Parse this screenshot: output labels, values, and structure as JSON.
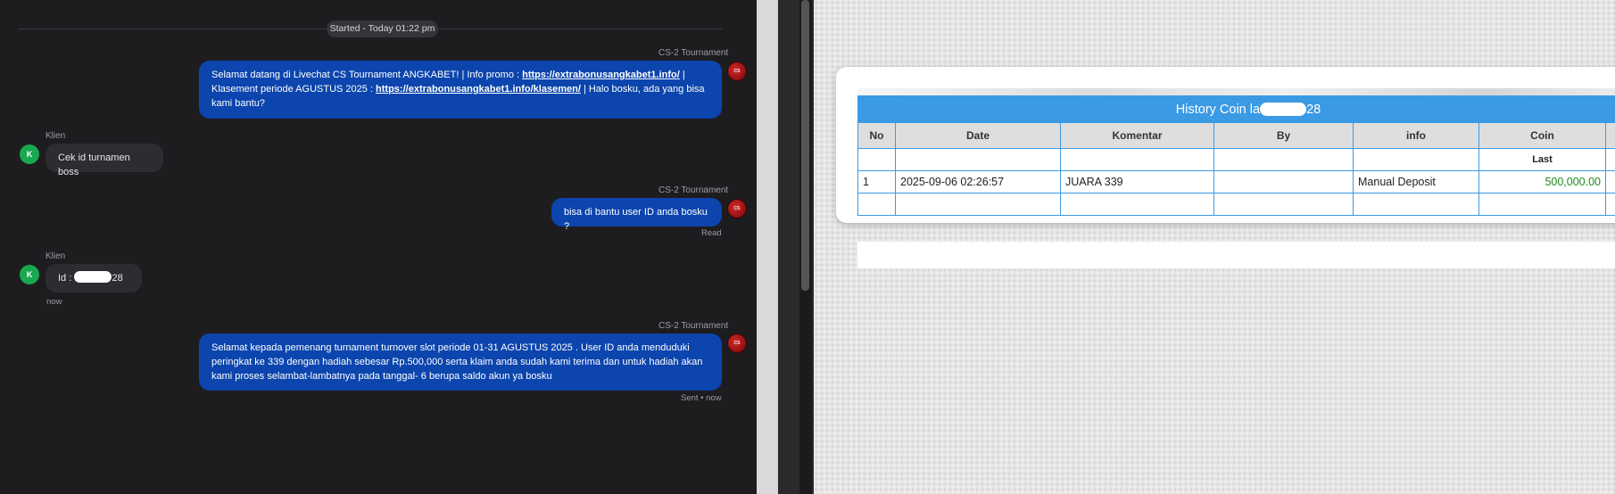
{
  "chat": {
    "session_label": "Started - Today 01:22 pm",
    "messages": [
      {
        "role": "agent",
        "sender": "CS-2 Tournament",
        "avatar": "CS",
        "text_1": "Selamat datang di Livechat CS Tournament ANGKABET! | Info promo : ",
        "link_1": "https://extrabonusangkabet1.info/",
        "text_2": " | Klasement periode AGUSTUS 2025 : ",
        "link_2": "https://extrabonusangkabet1.info/klasemen/",
        "text_3": " | Halo bosku, ada yang bisa kami bantu?"
      },
      {
        "role": "client",
        "sender": "Klien",
        "avatar": "K",
        "text": "Cek id turnamen boss"
      },
      {
        "role": "agent",
        "sender": "CS-2 Tournament",
        "avatar": "CS",
        "text": "bisa di bantu user ID anda bosku ?",
        "status": "Read"
      },
      {
        "role": "client",
        "sender": "Klien",
        "avatar": "K",
        "text_before": "Id : L",
        "text_after": "28",
        "status": "now"
      },
      {
        "role": "agent",
        "sender": "CS-2 Tournament",
        "avatar": "CS",
        "text": "Selamat kepada pemenang turnament turnover slot periode 01-31 AGUSTUS 2025 . User ID anda menduduki peringkat ke 339 dengan hadiah sebesar Rp.500,000 serta klaim anda sudah kami terima dan untuk hadiah akan kami proses selambat-lambatnya pada tanggal- 6 berupa saldo akun ya bosku",
        "status": "Sent • now"
      }
    ]
  },
  "history": {
    "title_before": "History Coin la",
    "title_after": "28",
    "columns": [
      "No",
      "Date",
      "Komentar",
      "By",
      "info",
      "Coin"
    ],
    "sub_header": "Last",
    "rows": [
      {
        "no": "1",
        "date": "2025-09-06 02:26:57",
        "komentar": "JUARA 339",
        "by": "",
        "info": "Manual Deposit",
        "coin": "500,000.00"
      }
    ]
  },
  "colors": {
    "agent_bubble": "#0c45ad",
    "client_bubble": "#2c2c31",
    "chat_background": "#1d1d20",
    "table_header": "#3b9ae4",
    "coin_text": "#1c8a1c",
    "client_avatar": "#1aa84f"
  }
}
